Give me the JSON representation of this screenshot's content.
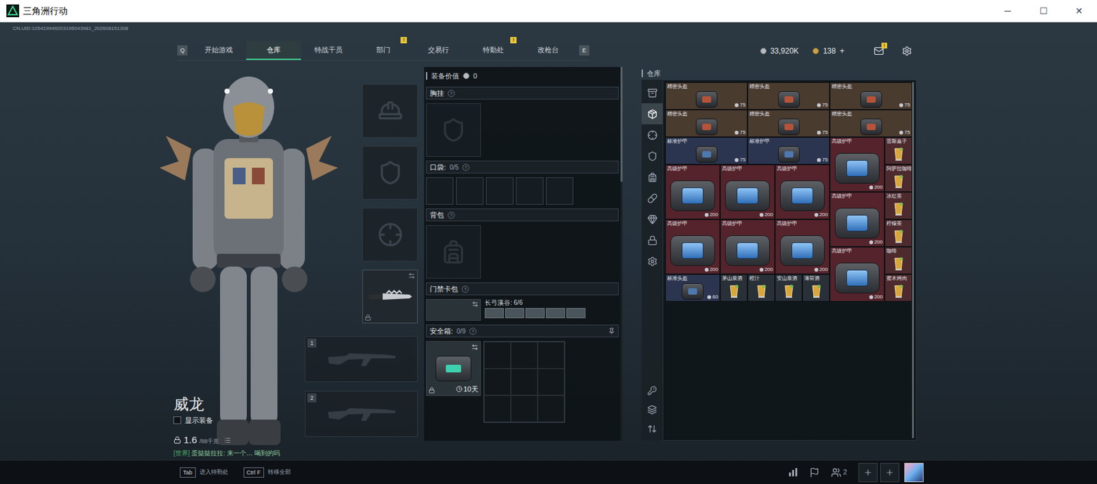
{
  "window": {
    "title": "三角洲行动",
    "controls": [
      "─",
      "☐",
      "✕"
    ]
  },
  "uid": "CN.UID:105419949203195043981_202606151308",
  "nav": {
    "prev_key": "Q",
    "next_key": "E",
    "tabs": [
      {
        "label": "开始游戏",
        "selected": false,
        "badge": ""
      },
      {
        "label": "仓库",
        "selected": true,
        "badge": ""
      },
      {
        "label": "特战干员",
        "selected": false,
        "badge": ""
      },
      {
        "label": "部门",
        "selected": false,
        "badge": "!"
      },
      {
        "label": "交易行",
        "selected": false,
        "badge": ""
      },
      {
        "label": "特勤处",
        "selected": false,
        "badge": "!"
      },
      {
        "label": "改枪台",
        "selected": false,
        "badge": ""
      }
    ]
  },
  "wallet": {
    "coins": "33,920K",
    "gold": "138",
    "add": "+",
    "mail_badge": "!"
  },
  "character": {
    "name": "威龙",
    "show_equipment": {
      "label": "显示装备",
      "checked": false
    },
    "weight": "1.6",
    "capacity": "/88千克"
  },
  "chat": {
    "channel": "[世界]",
    "text": "蛋挞挞拉拉: 来一个… 喝到的吗"
  },
  "equipment_slots": [
    {
      "kind": "helmet",
      "filled": false,
      "locked": false
    },
    {
      "kind": "armor",
      "filled": false,
      "locked": false
    },
    {
      "kind": "pistol",
      "filled": false,
      "locked": false
    },
    {
      "kind": "melee",
      "filled": true,
      "locked": true
    }
  ],
  "weapon_slots": [
    {
      "index": "1",
      "filled": false
    },
    {
      "index": "2",
      "filled": false
    }
  ],
  "loadout": {
    "value_label": "装备价值",
    "value": "0",
    "help": "?",
    "chest": {
      "label": "胸挂"
    },
    "pockets": {
      "label": "口袋:",
      "count": "0/5",
      "slots": [
        {
          "filled": false
        },
        {
          "filled": false
        },
        {
          "filled": false
        },
        {
          "filled": false
        },
        {
          "filled": false
        }
      ]
    },
    "backpack": {
      "label": "背包"
    },
    "keycards": {
      "label": "门禁卡包",
      "map": "长弓溪谷: 6/6",
      "cards": [
        {
          "filled": true
        },
        {
          "filled": true
        },
        {
          "filled": true
        },
        {
          "filled": true
        },
        {
          "filled": true
        }
      ]
    },
    "safe": {
      "label": "安全箱:",
      "count": "0/9",
      "duration": "10天",
      "locked": true,
      "cells": [
        {
          "filled": false
        },
        {
          "filled": false
        },
        {
          "filled": false
        },
        {
          "filled": false
        },
        {
          "filled": false
        },
        {
          "filled": false
        },
        {
          "filled": false
        },
        {
          "filled": false
        },
        {
          "filled": false
        }
      ]
    }
  },
  "warehouse": {
    "title": "仓库",
    "categories": [
      {
        "kind": "all",
        "selected": false
      },
      {
        "kind": "equipment",
        "selected": true
      },
      {
        "kind": "weapon",
        "selected": false
      },
      {
        "kind": "armor",
        "selected": false
      },
      {
        "kind": "backpack",
        "selected": false
      },
      {
        "kind": "medical",
        "selected": false
      },
      {
        "kind": "collection",
        "selected": false
      },
      {
        "kind": "locked",
        "selected": false
      },
      {
        "kind": "settings",
        "selected": false
      }
    ],
    "tools": [
      {
        "kind": "keycard"
      },
      {
        "kind": "layers"
      },
      {
        "kind": "sort"
      }
    ],
    "items": [
      {
        "name": "精密头盔",
        "value": "75",
        "kind": "precision_helmet",
        "color": "#4a3b2f"
      },
      {
        "name": "精密头盔",
        "value": "75",
        "kind": "precision_helmet",
        "color": "#4a3b2f"
      },
      {
        "name": "精密头盔",
        "value": "75",
        "kind": "precision_helmet",
        "color": "#4a3b2f"
      },
      {
        "name": "精密头盔",
        "value": "75",
        "kind": "precision_helmet",
        "color": "#4a3b2f"
      },
      {
        "name": "精密头盔",
        "value": "75",
        "kind": "precision_helmet",
        "color": "#4a3b2f"
      },
      {
        "name": "精密头盔",
        "value": "75",
        "kind": "precision_helmet",
        "color": "#4a3b2f"
      },
      {
        "name": "标准护甲",
        "value": "75",
        "kind": "standard_armor",
        "color": "#2c3550"
      },
      {
        "name": "标准护甲",
        "value": "75",
        "kind": "standard_armor",
        "color": "#2c3550"
      },
      {
        "name": "高级护甲",
        "value": "200",
        "kind": "advanced_armor",
        "color": "#55232b"
      },
      {
        "name": "雷斯嘉子",
        "kind": "drink",
        "color": "#4d2a2e"
      },
      {
        "name": "高级护甲",
        "value": "200",
        "kind": "advanced_armor",
        "color": "#55232b"
      },
      {
        "name": "高级护甲",
        "value": "200",
        "kind": "advanced_armor",
        "color": "#55232b"
      },
      {
        "name": "高级护甲",
        "value": "200",
        "kind": "advanced_armor",
        "color": "#55232b"
      },
      {
        "name": "阿萨拉咖啡",
        "kind": "drink",
        "color": "#4d2a2e"
      },
      {
        "name": "高级护甲",
        "value": "200",
        "kind": "advanced_armor",
        "color": "#55232b"
      },
      {
        "name": "冰红茶",
        "kind": "drink",
        "color": "#4d2a2e"
      },
      {
        "name": "高级护甲",
        "value": "200",
        "kind": "advanced_armor",
        "color": "#55232b"
      },
      {
        "name": "高级护甲",
        "value": "200",
        "kind": "advanced_armor",
        "color": "#55232b"
      },
      {
        "name": "高级护甲",
        "value": "200",
        "kind": "advanced_armor",
        "color": "#55232b"
      },
      {
        "name": "柠檬茶",
        "kind": "drink",
        "color": "#4d2a2e"
      },
      {
        "name": "高级护甲",
        "value": "200",
        "kind": "advanced_armor",
        "color": "#55232b"
      },
      {
        "name": "咖啡",
        "kind": "drink",
        "color": "#4d2a2e"
      },
      {
        "name": "标准头盔",
        "value": "60",
        "kind": "standard_helmet",
        "color": "#2c3550"
      },
      {
        "name": "茅山泉酒",
        "kind": "drink",
        "color": "#2a3038"
      },
      {
        "name": "橙汁",
        "kind": "drink",
        "color": "#2a3038"
      },
      {
        "name": "安山泉酒",
        "kind": "drink",
        "color": "#2a3038"
      },
      {
        "name": "薄荷酒",
        "kind": "drink",
        "color": "#2a3038"
      },
      {
        "name": "蜜木烤肉",
        "kind": "drink",
        "color": "#4d2a2e"
      }
    ]
  },
  "hints": [
    {
      "key": "Tab",
      "label": "进入特勤处"
    },
    {
      "key": "Ctrl F",
      "label": "转移全部"
    }
  ],
  "squad": {
    "count": "2"
  }
}
